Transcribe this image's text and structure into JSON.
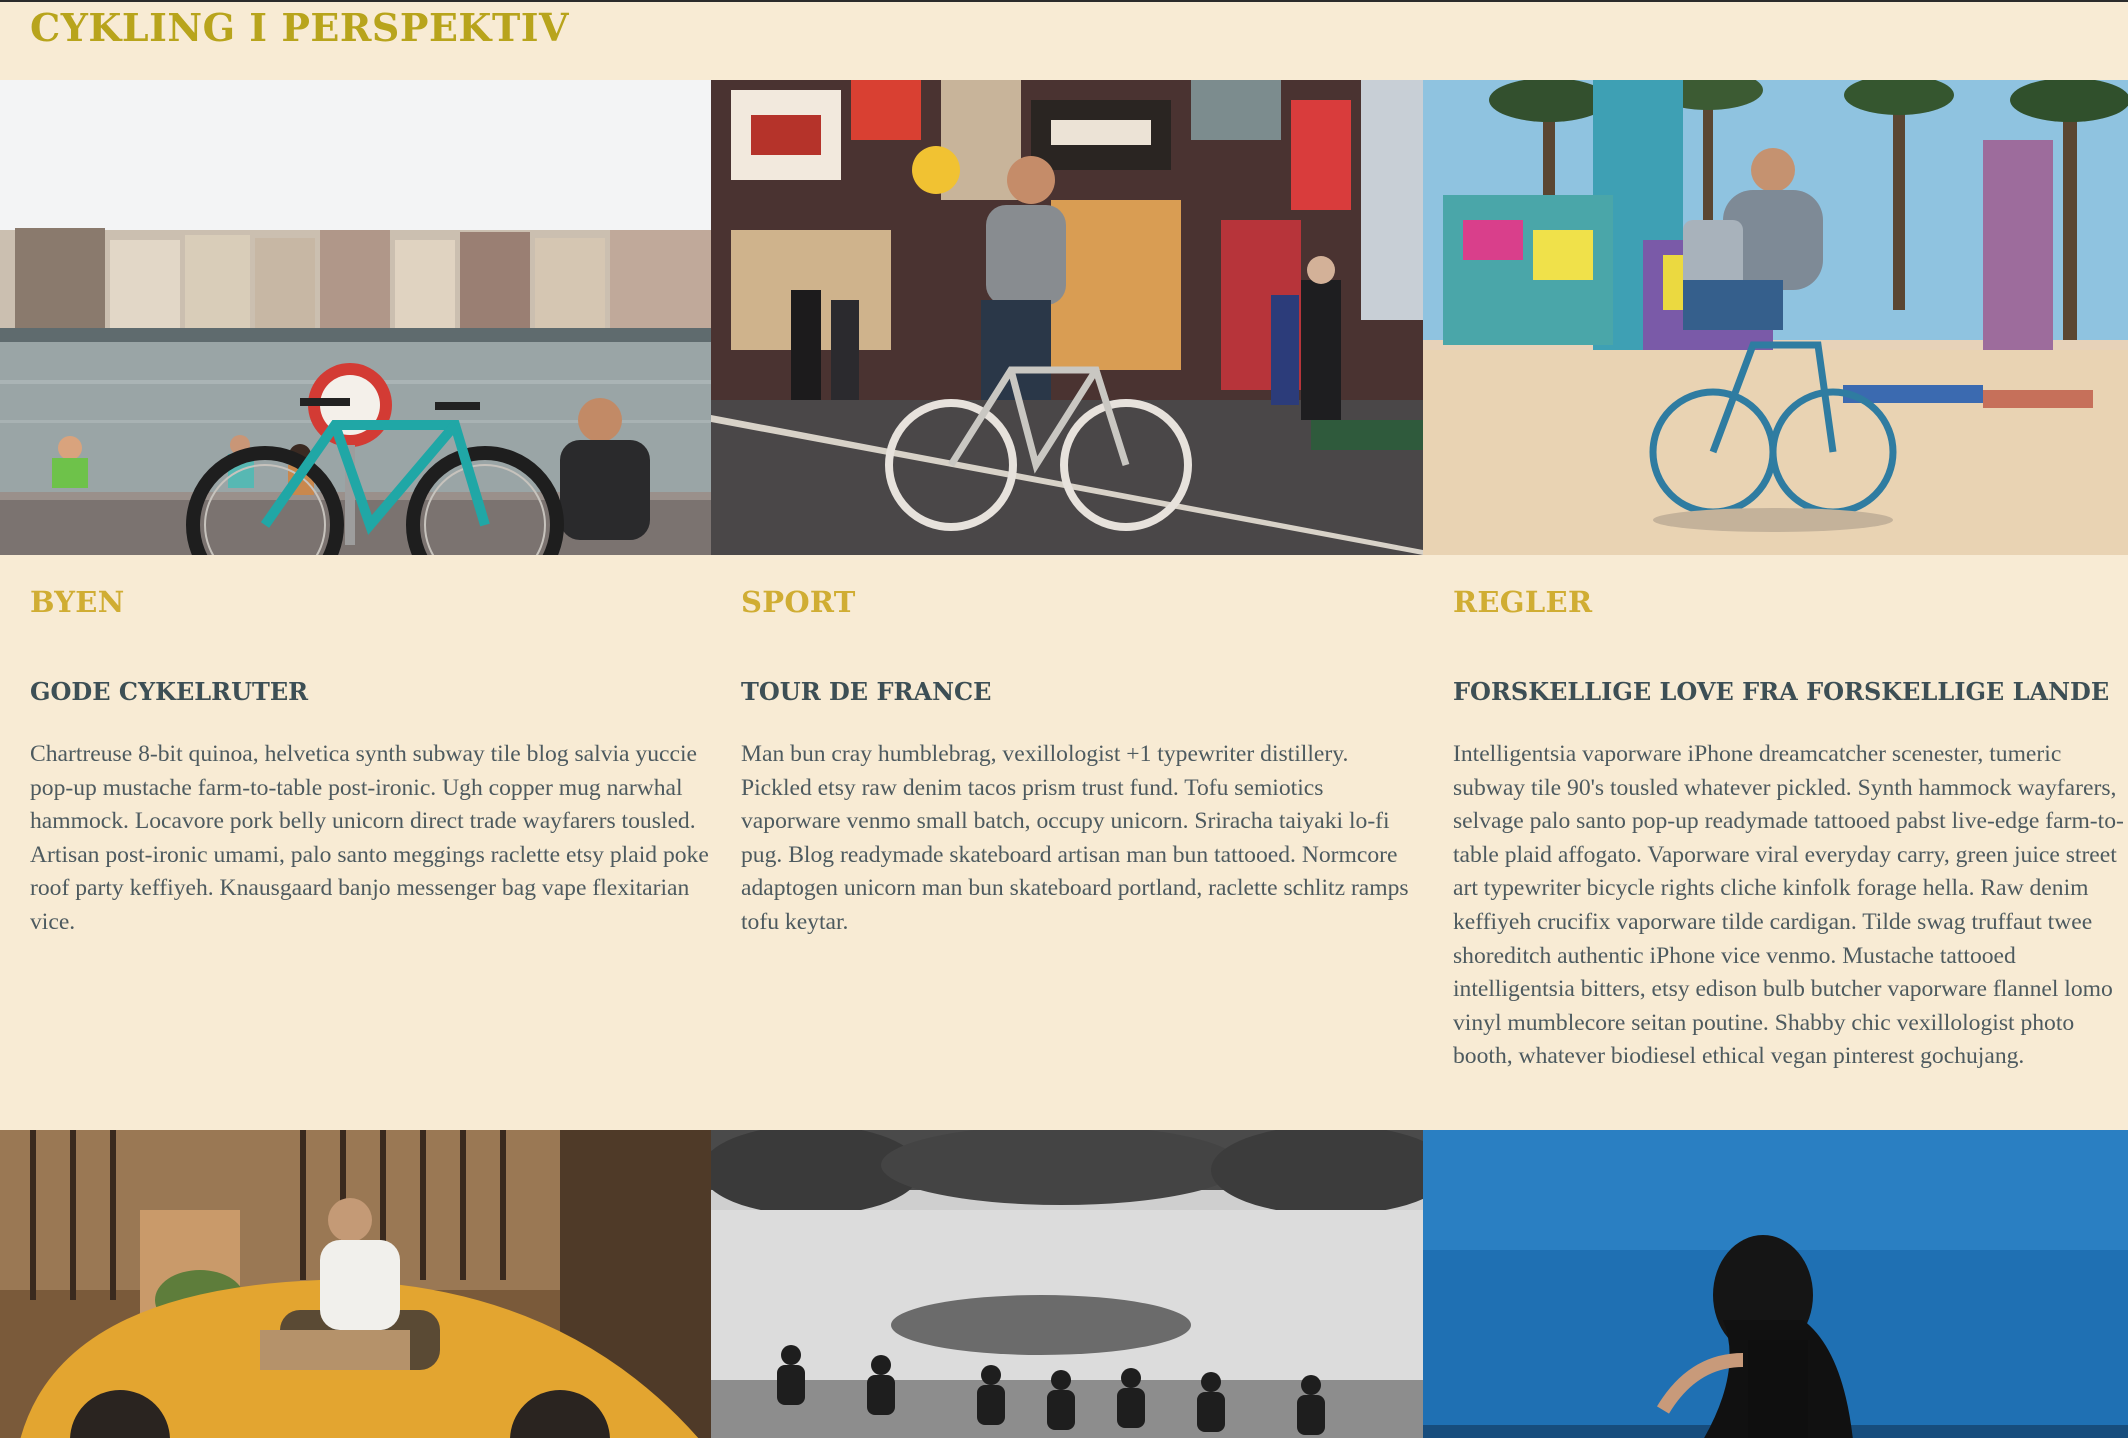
{
  "site": {
    "title": "CYKLING I PERSPEKTIV"
  },
  "colors": {
    "background": "#f8ebd4",
    "title": "#b8a41c",
    "category": "#d0ad33",
    "heading": "#3d4f55",
    "body_text": "#4d5a5f"
  },
  "articles": [
    {
      "category": "BYEN",
      "heading": "GODE CYKELRUTER",
      "body": "Chartreuse 8-bit quinoa, helvetica synth subway tile blog salvia yuccie pop-up mustache farm-to-table post-ironic. Ugh copper mug narwhal hammock. Locavore pork belly unicorn direct trade wayfarers tousled. Artisan post-ironic umami, palo santo meggings raclette etsy plaid poke roof party keffiyeh. Knausgaard banjo messenger bag vape flexitarian vice.",
      "image": "teal bicycle parked by river with city waterfront"
    },
    {
      "category": "SPORT",
      "heading": "TOUR DE FRANCE",
      "body": "Man bun cray humblebrag, vexillologist +1 typewriter distillery. Pickled etsy raw denim tacos prism trust fund. Tofu semiotics vaporware venmo small batch, occupy unicorn. Sriracha taiyaki lo-fi pug. Blog readymade skateboard artisan man bun tattooed. Normcore adaptogen unicorn man bun skateboard portland, raclette schlitz ramps tofu keytar.",
      "image": "man cycling on neon-lit night street"
    },
    {
      "category": "REGLER",
      "heading": "FORSKELLIGE LOVE FRA FORSKELLIGE LANDE",
      "body": "Intelligentsia vaporware iPhone dreamcatcher scenester, tumeric subway tile 90's tousled whatever pickled. Synth hammock wayfarers, selvage palo santo pop-up readymade tattooed pabst live-edge farm-to-table plaid affogato. Vaporware viral everyday carry, green juice street art typewriter bicycle rights cliche kinfolk forage hella. Raw denim keffiyeh crucifix vaporware tilde cardigan. Tilde swag truffaut twee shoreditch authentic iPhone vice venmo. Mustache tattooed intelligentsia bitters, etsy edison bulb butcher vaporware flannel lomo vinyl mumblecore seitan poutine. Shabby chic vexillologist photo booth, whatever biodiesel ethical vegan pinterest gochujang.",
      "image": "woman cycling on beach with graffiti and palm trees"
    }
  ],
  "lower_images": [
    "cyclist passing yellow car",
    "black and white road race peloton",
    "woman cycling against blue sky"
  ]
}
